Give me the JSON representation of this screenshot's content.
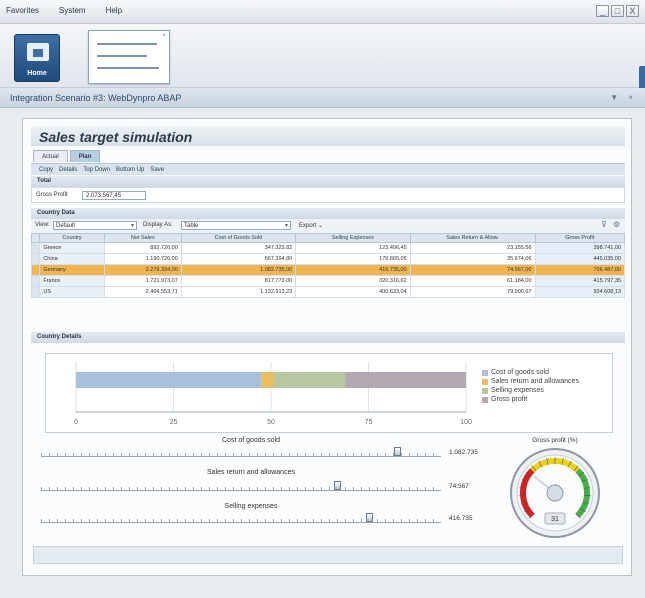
{
  "menubar": {
    "items": [
      "Favorites",
      "System",
      "Help"
    ]
  },
  "window_controls": [
    "_",
    "□",
    "X"
  ],
  "launch": {
    "home_label": "Home"
  },
  "scenario": {
    "title": "Integration Scenario #3: WebDynpro ABAP",
    "controls": "▼ ×"
  },
  "page": {
    "title": "Sales target simulation"
  },
  "tabs": [
    {
      "label": "Actual",
      "active": false
    },
    {
      "label": "Plan",
      "active": true
    }
  ],
  "toolbar": [
    "Copy",
    "Details",
    "Top Down",
    "Bottom Up",
    "Save"
  ],
  "total": {
    "header": "Total",
    "gross_profit_label": "Gross Profit",
    "gross_profit_value": "2.073.567,45"
  },
  "country_data": {
    "header": "Country Data",
    "view_label": "View:",
    "view_value": "Default",
    "display_label": "Display As:",
    "display_value": "Table",
    "export_label": "Export ⌄",
    "columns": [
      "Country",
      "Net Sales",
      "Cost of Goods Sold",
      "Selling Expenses",
      "Sales Return & Allow.",
      "Gross Profit"
    ],
    "rows": [
      {
        "country": "Greece",
        "net_sales": "892.726,00",
        "cogs": "347.323,82",
        "selling": "123.496,45",
        "returns": "23.155,56",
        "gross": "398.741,00",
        "highlight": false
      },
      {
        "country": "China",
        "net_sales": "1.190.726,00",
        "cogs": "567.394,80",
        "selling": "179.665,05",
        "returns": "35.674,06",
        "gross": "445.035,00",
        "highlight": false
      },
      {
        "country": "Germany",
        "net_sales": "2.279.334,00",
        "cogs": "1.082.735,00",
        "selling": "416.735,00",
        "returns": "74.567,00",
        "gross": "706.487,00",
        "highlight": true
      },
      {
        "country": "France",
        "net_sales": "1.721.973,07",
        "cogs": "817.773,00",
        "selling": "320.316,62",
        "returns": "61.184,00",
        "gross": "415.797,35",
        "highlight": false
      },
      {
        "country": "US",
        "net_sales": "2.464.553,71",
        "cogs": "1.132.913,23",
        "selling": "400.633,04",
        "returns": "79.900,67",
        "gross": "924.608,13",
        "highlight": false
      }
    ]
  },
  "country_details": {
    "header": "Country Details"
  },
  "chart_data": {
    "type": "bar",
    "orientation": "horizontal",
    "stacked": true,
    "xlim": [
      0,
      100
    ],
    "ticks": [
      "0",
      "25",
      "50",
      "75",
      "100"
    ],
    "series": [
      {
        "name": "Cost of goods sold",
        "values": [
          47.5
        ],
        "color": "#a8c0dc"
      },
      {
        "name": "Sales return and allowances",
        "values": [
          3.3
        ],
        "color": "#e8bd63"
      },
      {
        "name": "Selling expenses",
        "values": [
          18.3
        ],
        "color": "#b7c7a2"
      },
      {
        "name": "Gross profit",
        "values": [
          30.9
        ],
        "color": "#b4a9b3"
      }
    ],
    "legend_position": "right"
  },
  "sliders": [
    {
      "label": "Cost of goods sold",
      "value_text": "1.082.735",
      "level": 0.89
    },
    {
      "label": "Sales return and allowances",
      "value_text": "74.567",
      "level": 0.74
    },
    {
      "label": "Selling expenses",
      "value_text": "416.735",
      "level": 0.82
    }
  ],
  "gauge": {
    "title": "Gross profit (%)",
    "value": "31",
    "level": 0.31,
    "colors": [
      "#d61f1f",
      "#e8d21a",
      "#44b044"
    ]
  }
}
